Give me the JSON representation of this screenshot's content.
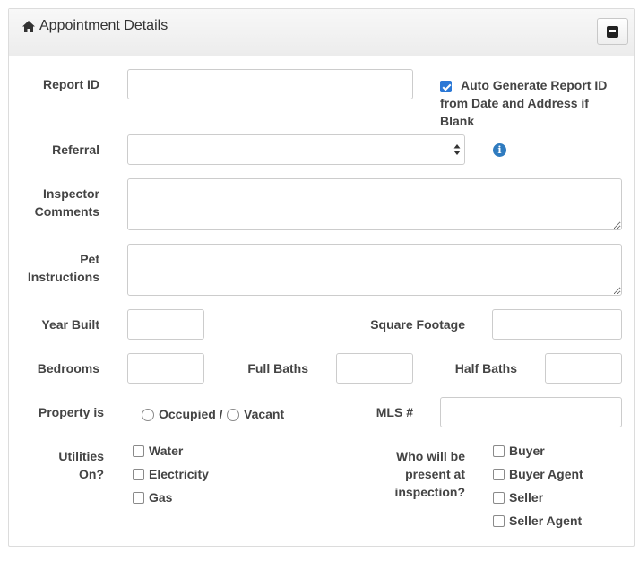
{
  "panel": {
    "title": "Appointment Details",
    "collapse_icon": "minus-square-icon",
    "title_icon": "home-icon"
  },
  "form": {
    "report_id": {
      "label": "Report ID",
      "value": ""
    },
    "auto_generate": {
      "checked": true,
      "label_line1": "Auto Generate Report ID",
      "label_line2": "from Date and Address if",
      "label_line3": "Blank"
    },
    "referral": {
      "label": "Referral",
      "value": "",
      "info_icon": "info-circle-icon"
    },
    "inspector_comments": {
      "label_line1": "Inspector",
      "label_line2": "Comments",
      "value": ""
    },
    "pet_instructions": {
      "label_line1": "Pet",
      "label_line2": "Instructions",
      "value": ""
    },
    "year_built": {
      "label": "Year Built",
      "value": ""
    },
    "square_footage": {
      "label": "Square Footage",
      "value": ""
    },
    "bedrooms": {
      "label": "Bedrooms",
      "value": ""
    },
    "full_baths": {
      "label": "Full Baths",
      "value": ""
    },
    "half_baths": {
      "label": "Half Baths",
      "value": ""
    },
    "property_is": {
      "label": "Property is",
      "option_occupied": "Occupied /",
      "option_vacant": "Vacant"
    },
    "mls": {
      "label": "MLS #",
      "value": ""
    },
    "utilities": {
      "label_line1": "Utilities",
      "label_line2": "On?",
      "items": [
        "Water",
        "Electricity",
        "Gas"
      ]
    },
    "present": {
      "label_line1": "Who will be",
      "label_line2": "present at",
      "label_line3": "inspection?",
      "items": [
        "Buyer",
        "Buyer Agent",
        "Seller",
        "Seller Agent"
      ]
    }
  }
}
